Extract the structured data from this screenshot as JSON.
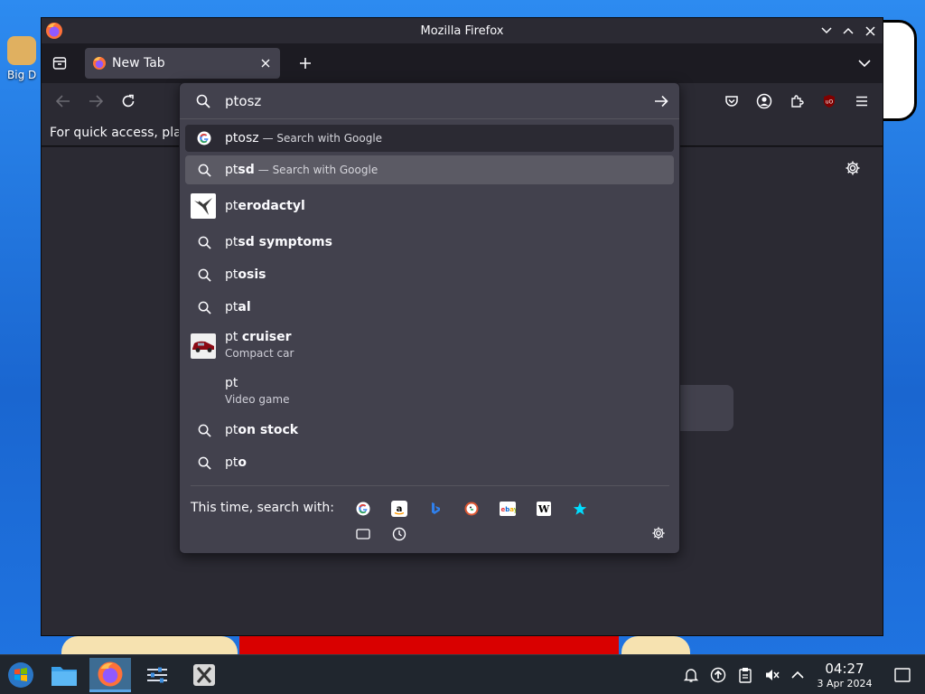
{
  "window": {
    "title": "Mozilla Firefox"
  },
  "desktop": {
    "icon_label": "Big D"
  },
  "tabs": [
    {
      "label": "New Tab"
    }
  ],
  "bookmarks_bar": {
    "message": "For quick access, plac"
  },
  "urlbar": {
    "value": "ptosz"
  },
  "suggestions": [
    {
      "typed": "ptosz",
      "completion": "",
      "action": "— Search with Google",
      "kind": "google",
      "state": "highlight"
    },
    {
      "typed": "pt",
      "completion": "sd",
      "action": "— Search with Google",
      "kind": "search",
      "state": "selected"
    },
    {
      "typed": "pt",
      "completion": "erodactyl",
      "kind": "thumb-pterodactyl"
    },
    {
      "typed": "pt",
      "completion": "sd symptoms",
      "kind": "search"
    },
    {
      "typed": "pt",
      "completion": "osis",
      "kind": "search"
    },
    {
      "typed": "pt",
      "completion": "al",
      "kind": "search"
    },
    {
      "typed": "pt ",
      "completion": "cruiser",
      "subtitle": "Compact car",
      "kind": "thumb-car"
    },
    {
      "typed": "pt",
      "completion": "",
      "subtitle": "Video game",
      "kind": "none"
    },
    {
      "typed": "pt",
      "completion": "on stock",
      "kind": "search"
    },
    {
      "typed": "pt",
      "completion": "o",
      "kind": "search"
    }
  ],
  "one_off": {
    "label": "This time, search with:",
    "engines": [
      "Google",
      "Amazon",
      "Bing",
      "DuckDuckGo",
      "eBay",
      "Wikipedia",
      "Bookmarks"
    ]
  },
  "taskbar": {
    "time": "04:27",
    "date": "3 Apr 2024"
  },
  "colors": {
    "accent": "#00ddff",
    "panel": "#42414d",
    "toolbar": "#2b2a33",
    "frame": "#1c1b22"
  }
}
